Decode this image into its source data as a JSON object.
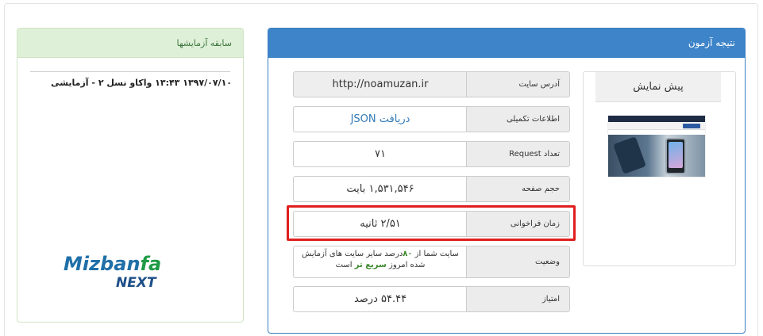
{
  "result_panel": {
    "title": "نتیجه آزمون",
    "preview_title": "پیش نمایش",
    "rows": [
      {
        "label": "آدرس سایت",
        "value": "http://noamuzan.ir"
      },
      {
        "label": "اطلاعات تکمیلی",
        "value": "دریافت JSON"
      },
      {
        "label": "تعداد Request",
        "value": "۷۱"
      },
      {
        "label": "حجم صفحه",
        "value": "۱,۵۳۱,۵۴۶ بایت"
      },
      {
        "label": "زمان فراخوانی",
        "value": "۲/۵۱ ثانیه"
      },
      {
        "label": "وضعیت",
        "value_part1": "سایت شما از ",
        "value_percent": "۸۰",
        "value_part2": "درصد سایر سایت های آزمایش شده امروز ",
        "value_fast": "سریع تر",
        "value_part3": "است"
      },
      {
        "label": "امتیاز",
        "value": "۵۴.۴۴ درصد"
      }
    ]
  },
  "history_panel": {
    "title": "سابقه آزمایشها",
    "items": [
      "۱۳۹۷/۰۷/۱۰ ۱۳:۴۳ واکاو نسل ۲ - آزمایشی"
    ]
  },
  "logo": {
    "main": "Mizban",
    "fa": "fa",
    "sub": "NEXT"
  },
  "colors": {
    "primary": "#3d84c8",
    "success_bg": "#dff0d8",
    "highlight": "#e01f1f"
  }
}
